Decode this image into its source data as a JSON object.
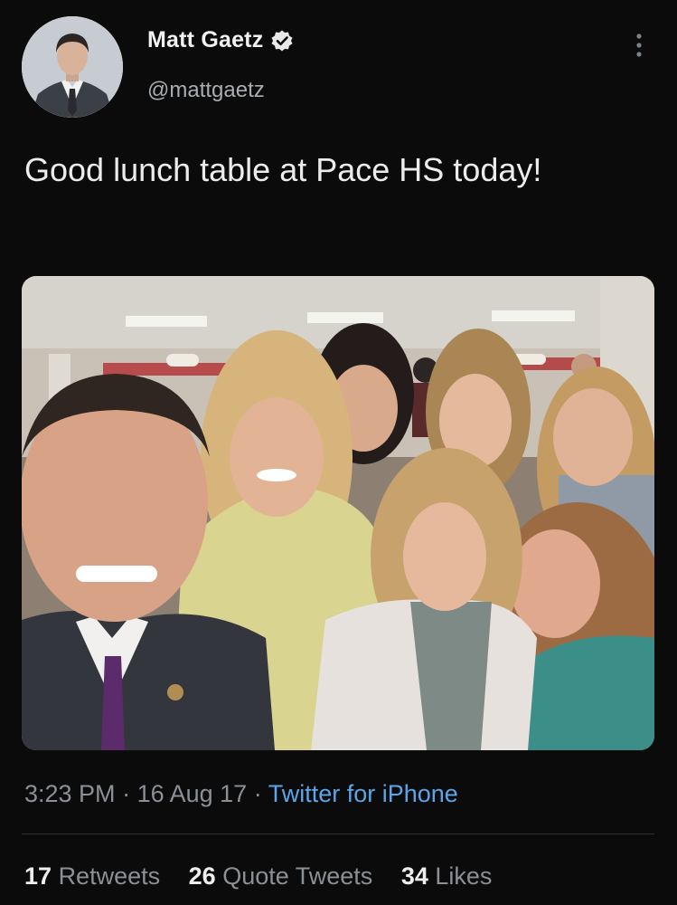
{
  "author": {
    "display_name": "Matt Gaetz",
    "handle": "@mattgaetz",
    "verified_icon": "verified-badge-icon"
  },
  "tweet": {
    "text": "Good lunch table at Pace HS today!"
  },
  "meta": {
    "time": "3:23 PM",
    "sep1": " · ",
    "date": "16 Aug 17",
    "sep2": " · ",
    "source": "Twitter for iPhone"
  },
  "stats": {
    "retweets_count": "17",
    "retweets_label": "Retweets",
    "quotes_count": "26",
    "quotes_label": "Quote Tweets",
    "likes_count": "34",
    "likes_label": "Likes"
  },
  "colors": {
    "background": "#0b0b0c",
    "link": "#5aa6e8",
    "muted_text": "#8b9096"
  }
}
